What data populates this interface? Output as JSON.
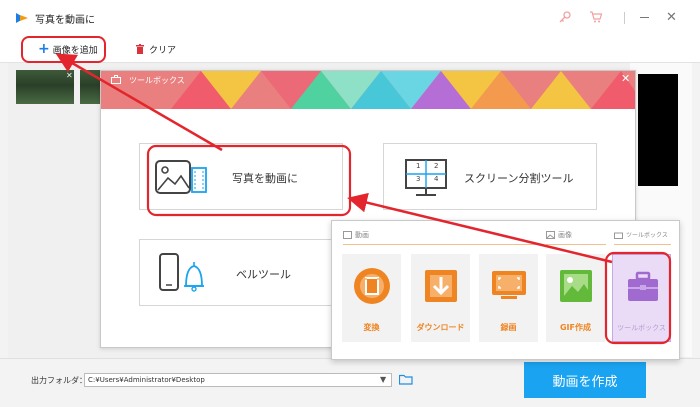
{
  "window": {
    "title": "写真を動画に",
    "key_icon": "key-icon",
    "cart_icon": "cart-icon",
    "close_label": "✕"
  },
  "toolbar": {
    "add_label": "画像を追加",
    "clear_label": "クリア"
  },
  "toolbox_dialog": {
    "title": "ツールボックス",
    "close_label": "✕",
    "cards": [
      {
        "label": "写真を動画に",
        "icon": "photo-to-video-icon"
      },
      {
        "label": "スクリーン分割ツール",
        "icon": "split-screen-icon"
      },
      {
        "label": "ベルツール",
        "icon": "bell-icon"
      }
    ],
    "split_icon_numbers": [
      "1",
      "2",
      "3",
      "4"
    ]
  },
  "main_window": {
    "sections": {
      "video": "動画",
      "image": "画像",
      "toolbox": "ツールボックス"
    },
    "tiles": [
      {
        "label": "変換",
        "icon": "film-reel-icon"
      },
      {
        "label": "ダウンロード",
        "icon": "download-icon"
      },
      {
        "label": "録画",
        "icon": "screen-record-icon"
      },
      {
        "label": "GIF作成",
        "icon": "gif-image-icon"
      },
      {
        "label": "ツールボックス",
        "icon": "toolbox-icon"
      }
    ]
  },
  "bottom": {
    "output_label": "出力フォルダ：",
    "output_path": "C:¥Users¥Administrator¥Desktop",
    "create_label": "動画を作成"
  },
  "colors": {
    "accent_blue": "#1aa3f0",
    "annotation_red": "#e3262d",
    "tile_orange": "#ee8522",
    "tile_green": "#63b939",
    "toolbox_purple": "#a06ad0"
  }
}
